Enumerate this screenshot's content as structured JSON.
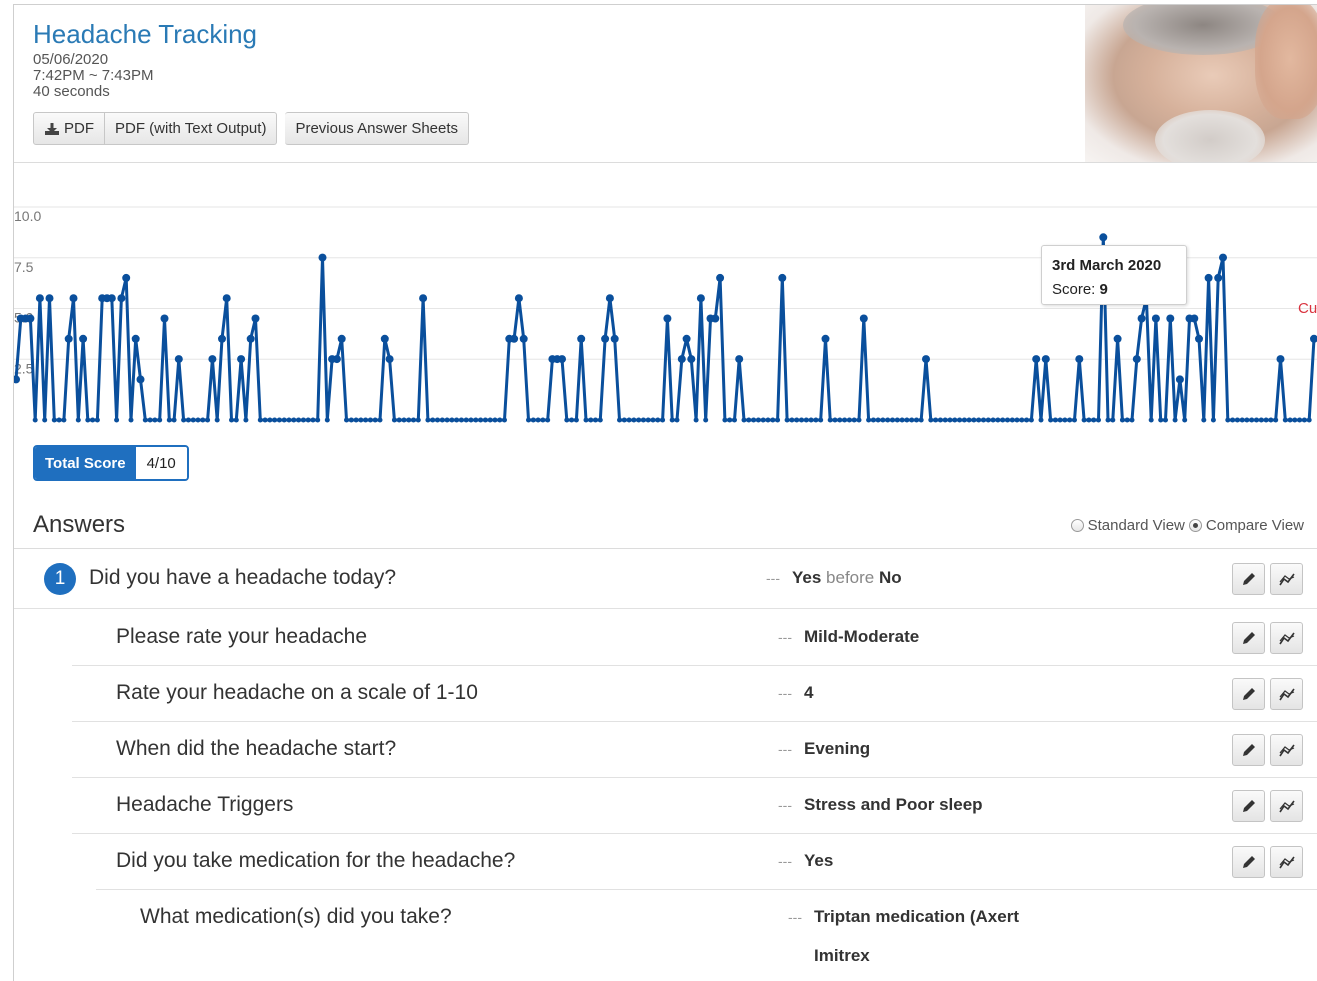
{
  "header": {
    "title": "Headache Tracking",
    "date": "05/06/2020",
    "time_range": "7:42PM ~ 7:43PM",
    "duration": "40 seconds",
    "buttons": {
      "pdf": "PDF",
      "pdf_text": "PDF (with Text Output)",
      "previous": "Previous Answer Sheets"
    }
  },
  "colors": {
    "accent": "#1f6fbf",
    "title_blue": "#2a7ab5",
    "series": "#0a4f9c",
    "cutoff": "#d9333f"
  },
  "chart_data": {
    "type": "line",
    "ylim": [
      0,
      10
    ],
    "y_ticks": [
      "10.0",
      "7.5",
      "5.0",
      "2.5"
    ],
    "grid": true,
    "values": [
      2,
      5,
      5,
      5,
      0,
      6,
      0,
      6,
      0,
      0,
      0,
      4,
      6,
      0,
      4,
      0,
      0,
      0,
      6,
      6,
      6,
      0,
      6,
      7,
      0,
      4,
      2,
      0,
      0,
      0,
      0,
      5,
      0,
      0,
      3,
      0,
      0,
      0,
      0,
      0,
      0,
      3,
      0,
      4,
      6,
      0,
      0,
      3,
      0,
      4,
      5,
      0,
      0,
      0,
      0,
      0,
      0,
      0,
      0,
      0,
      0,
      0,
      0,
      0,
      8,
      0,
      3,
      3,
      4,
      0,
      0,
      0,
      0,
      0,
      0,
      0,
      0,
      4,
      3,
      0,
      0,
      0,
      0,
      0,
      0,
      6,
      0,
      0,
      0,
      0,
      0,
      0,
      0,
      0,
      0,
      0,
      0,
      0,
      0,
      0,
      0,
      0,
      0,
      4,
      4,
      6,
      4,
      0,
      0,
      0,
      0,
      0,
      3,
      3,
      3,
      0,
      0,
      0,
      4,
      0,
      0,
      0,
      0,
      4,
      6,
      4,
      0,
      0,
      0,
      0,
      0,
      0,
      0,
      0,
      0,
      0,
      5,
      0,
      0,
      3,
      4,
      3,
      0,
      6,
      0,
      5,
      5,
      7,
      0,
      0,
      0,
      3,
      0,
      0,
      0,
      0,
      0,
      0,
      0,
      0,
      7,
      0,
      0,
      0,
      0,
      0,
      0,
      0,
      0,
      4,
      0,
      0,
      0,
      0,
      0,
      0,
      0,
      5,
      0,
      0,
      0,
      0,
      0,
      0,
      0,
      0,
      0,
      0,
      0,
      0,
      3,
      0,
      0,
      0,
      0,
      0,
      0,
      0,
      0,
      0,
      0,
      0,
      0,
      0,
      0,
      0,
      0,
      0,
      0,
      0,
      0,
      0,
      0,
      3,
      0,
      3,
      0,
      0,
      0,
      0,
      0,
      0,
      3,
      0,
      0,
      0,
      0,
      9,
      0,
      0,
      4,
      0,
      0,
      0,
      3,
      5,
      6,
      0,
      5,
      0,
      0,
      5,
      0,
      2,
      0,
      5,
      5,
      4,
      0,
      7,
      0,
      7,
      8,
      0,
      0,
      0,
      0,
      0,
      0,
      0,
      0,
      0,
      0,
      0,
      3,
      0,
      0,
      0,
      0,
      0,
      0,
      4
    ],
    "tooltip": {
      "date": "3rd March 2020",
      "score_label": "Score:",
      "score": "9"
    },
    "cutoff_label": "Cu"
  },
  "total_score": {
    "label": "Total Score",
    "value": "4/10"
  },
  "answers": {
    "title": "Answers",
    "standard_view": "Standard View",
    "compare_view": "Compare View",
    "items": [
      {
        "num": "1",
        "question": "Did you have a headache today?",
        "answer": "Yes",
        "answer_extra": " before ",
        "answer_prev": "No"
      },
      {
        "question": "Please rate your headache",
        "answer": "Mild-Moderate"
      },
      {
        "question": "Rate your headache on a scale of 1-10",
        "answer": "4"
      },
      {
        "question": "When did the headache start?",
        "answer": "Evening"
      },
      {
        "question": "Headache Triggers",
        "answer": "Stress and Poor sleep"
      },
      {
        "question": "Did you take medication for the headache?",
        "answer": "Yes"
      },
      {
        "question": "What medication(s) did you take?",
        "answer": "Triptan medication (Axert",
        "answer_line2": "Imitrex"
      }
    ],
    "dash": "---"
  }
}
